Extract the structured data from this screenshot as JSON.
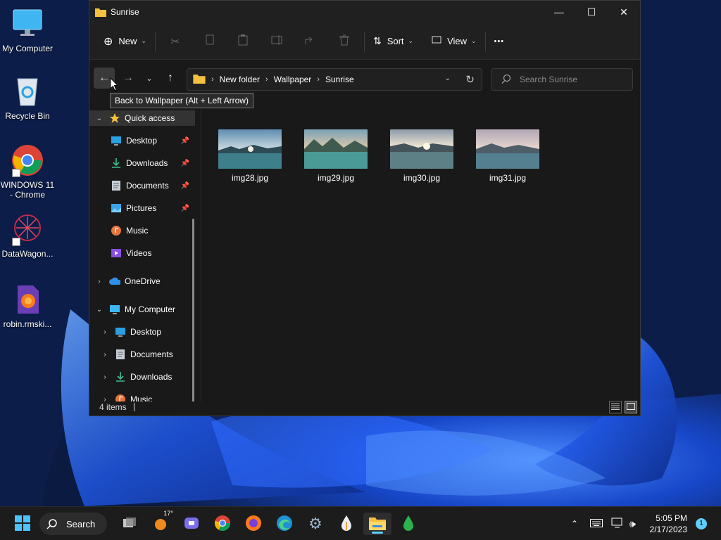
{
  "desktop": {
    "icons": [
      {
        "label": "My Computer",
        "icon": "monitor-icon"
      },
      {
        "label": "Recycle Bin",
        "icon": "recycle-bin-icon"
      },
      {
        "label": "WINDOWS 11 - Chrome",
        "icon": "chrome-icon"
      },
      {
        "label": "DataWagon...",
        "icon": "datawagon-icon"
      },
      {
        "label": "robin.rmski...",
        "icon": "firefox-file-icon"
      }
    ]
  },
  "window": {
    "title": "Sunrise",
    "controls": {
      "minimize": "—",
      "maximize": "☐",
      "close": "✕"
    }
  },
  "commandbar": {
    "new_label": "New",
    "sort_label": "Sort",
    "view_label": "View",
    "more_label": "•••"
  },
  "address": {
    "crumbs": [
      "New folder",
      "Wallpaper",
      "Sunrise"
    ],
    "search_placeholder": "Search Sunrise"
  },
  "tooltip": "Back to Wallpaper (Alt + Left Arrow)",
  "navpane": {
    "items": [
      {
        "label": "Quick access",
        "icon": "star-icon",
        "expander": "⌄",
        "selected": true
      },
      {
        "label": "Desktop",
        "icon": "desktop-icon",
        "pinned": true
      },
      {
        "label": "Downloads",
        "icon": "download-icon",
        "pinned": true
      },
      {
        "label": "Documents",
        "icon": "documents-icon",
        "pinned": true
      },
      {
        "label": "Pictures",
        "icon": "pictures-icon",
        "pinned": true
      },
      {
        "label": "Music",
        "icon": "music-icon"
      },
      {
        "label": "Videos",
        "icon": "videos-icon"
      },
      {
        "label": "OneDrive",
        "icon": "cloud-icon",
        "expander": "›"
      },
      {
        "label": "My Computer",
        "icon": "computer-icon",
        "expander": "⌄"
      },
      {
        "label": "Desktop",
        "icon": "desktop-icon",
        "expander": "›"
      },
      {
        "label": "Documents",
        "icon": "documents-icon",
        "expander": "›"
      },
      {
        "label": "Downloads",
        "icon": "download-icon",
        "expander": "›"
      },
      {
        "label": "Music",
        "icon": "music-icon",
        "expander": "›"
      }
    ]
  },
  "files": [
    {
      "name": "img28.jpg"
    },
    {
      "name": "img29.jpg"
    },
    {
      "name": "img30.jpg"
    },
    {
      "name": "img31.jpg"
    }
  ],
  "status": {
    "count": "4 items"
  },
  "taskbar": {
    "search_label": "Search",
    "weather_temp": "17°",
    "time": "5:05 PM",
    "date": "2/17/2023",
    "notifications": "1",
    "apps": [
      "file-explorer-icon",
      "chrome-icon",
      "firefox-icon",
      "edge-icon",
      "settings-icon",
      "teams-icon"
    ]
  },
  "colors": {
    "accent": "#60cdff",
    "folder": "#f5c13f",
    "window_bg": "#191919",
    "titlebar_bg": "#202020"
  }
}
